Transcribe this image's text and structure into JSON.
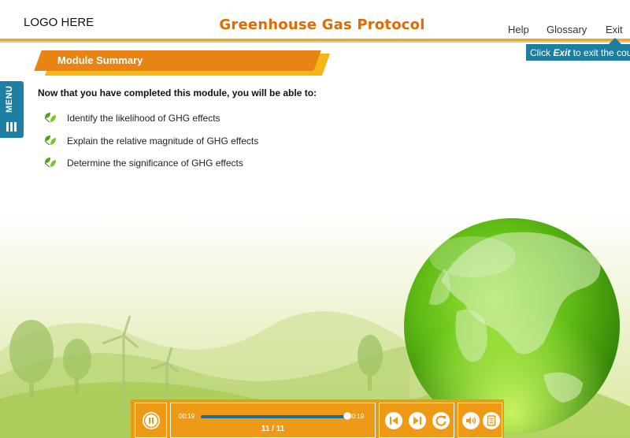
{
  "header": {
    "logo": "LOGO HERE",
    "title": "Greenhouse Gas Protocol",
    "nav": {
      "help": "Help",
      "glossary": "Glossary",
      "exit": "Exit"
    },
    "exit_tooltip": {
      "prefix": "Click ",
      "emphasis": "Exit",
      "suffix": " to exit the course"
    }
  },
  "menu": {
    "label": "MENU",
    "icon": "hamburger-icon"
  },
  "section": {
    "title": "Module Summary",
    "intro": "Now that you have completed this module, you will be able to:",
    "objectives": [
      "Identify the likelihood of GHG effects",
      "Explain the relative magnitude of GHG effects",
      "Determine the significance of GHG effects"
    ],
    "bullet_icon": "leaf-icon"
  },
  "player": {
    "play_state": "playing",
    "play_icon": "pause-icon",
    "current_time": "00:19",
    "total_time": "00:19",
    "progress": 1.0,
    "page": "11 / 11",
    "controls": [
      "previous-icon",
      "next-icon",
      "replay-icon",
      "volume-icon",
      "transcript-icon"
    ]
  },
  "colors": {
    "accent_orange": "#e88413",
    "banner_yellow": "#f5b51b",
    "title_orange": "#e06b00",
    "tooltip_blue": "#1a7fa0",
    "scene_green": "#7bbb2a"
  }
}
